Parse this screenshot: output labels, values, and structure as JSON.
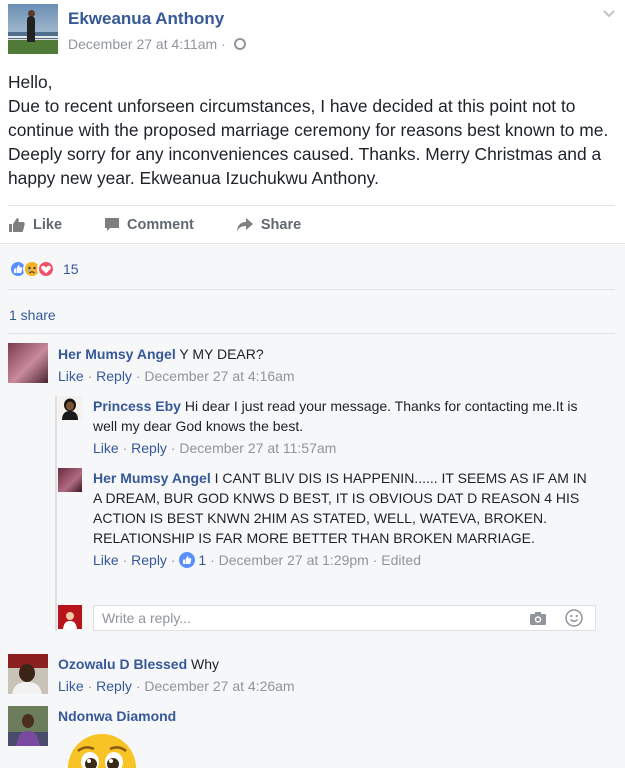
{
  "post": {
    "author": "Ekweanua Anthony",
    "timestamp": "December 27 at 4:11am",
    "separator": "·",
    "privacy_icon": "globe-icon",
    "menu_icon": "chevron-down-icon",
    "text_lines": [
      "Hello,",
      "Due to recent unforseen circumstances, I have decided at this point not to continue with the proposed marriage ceremony for reasons best known to me. Deeply sorry for any inconveniences caused. Thanks. Merry Christmas and a happy new year. Ekweanua Izuchukwu Anthony."
    ]
  },
  "actions": {
    "like": "Like",
    "comment": "Comment",
    "share": "Share"
  },
  "reactions": {
    "icons": [
      "like-reaction-icon",
      "sad-reaction-icon",
      "love-reaction-icon"
    ],
    "count": "15"
  },
  "shares": "1 share",
  "comments": [
    {
      "name": "Her Mumsy Angel",
      "text": " Y MY DEAR?",
      "like": "Like",
      "reply": "Reply",
      "time": "December 27 at 4:16am",
      "replies": [
        {
          "name": "Princess Eby",
          "text": " Hi dear I just read your message. Thanks for contacting me.It is well my dear God knows the best.",
          "like": "Like",
          "reply": "Reply",
          "time": "December 27 at 11:57am"
        },
        {
          "name": "Her Mumsy Angel",
          "text": " I CANT BLIV DIS IS HAPPENIN...... IT SEEMS AS IF AM IN A DREAM, BUR GOD KNWS D BEST, IT IS OBVIOUS DAT D REASON 4 HIS ACTION IS BEST KNWN 2HIM AS STATED, WELL, WATEVA, BROKEN. RELATIONSHIP IS FAR MORE BETTER THAN BROKEN MARRIAGE.",
          "like": "Like",
          "reply": "Reply",
          "like_count": "1",
          "time": "December 27 at 1:29pm",
          "edited": "Edited"
        }
      ]
    },
    {
      "name": "Ozowalu D Blessed",
      "text": " Why",
      "like": "Like",
      "reply": "Reply",
      "time": "December 27 at 4:26am"
    },
    {
      "name": "Ndonwa Diamond",
      "text": ""
    }
  ],
  "reply_box": {
    "placeholder": "Write a reply..."
  },
  "colors": {
    "link": "#365899",
    "meta": "#90949c",
    "text": "#1d2129",
    "comments_bg": "#f6f7f9"
  }
}
